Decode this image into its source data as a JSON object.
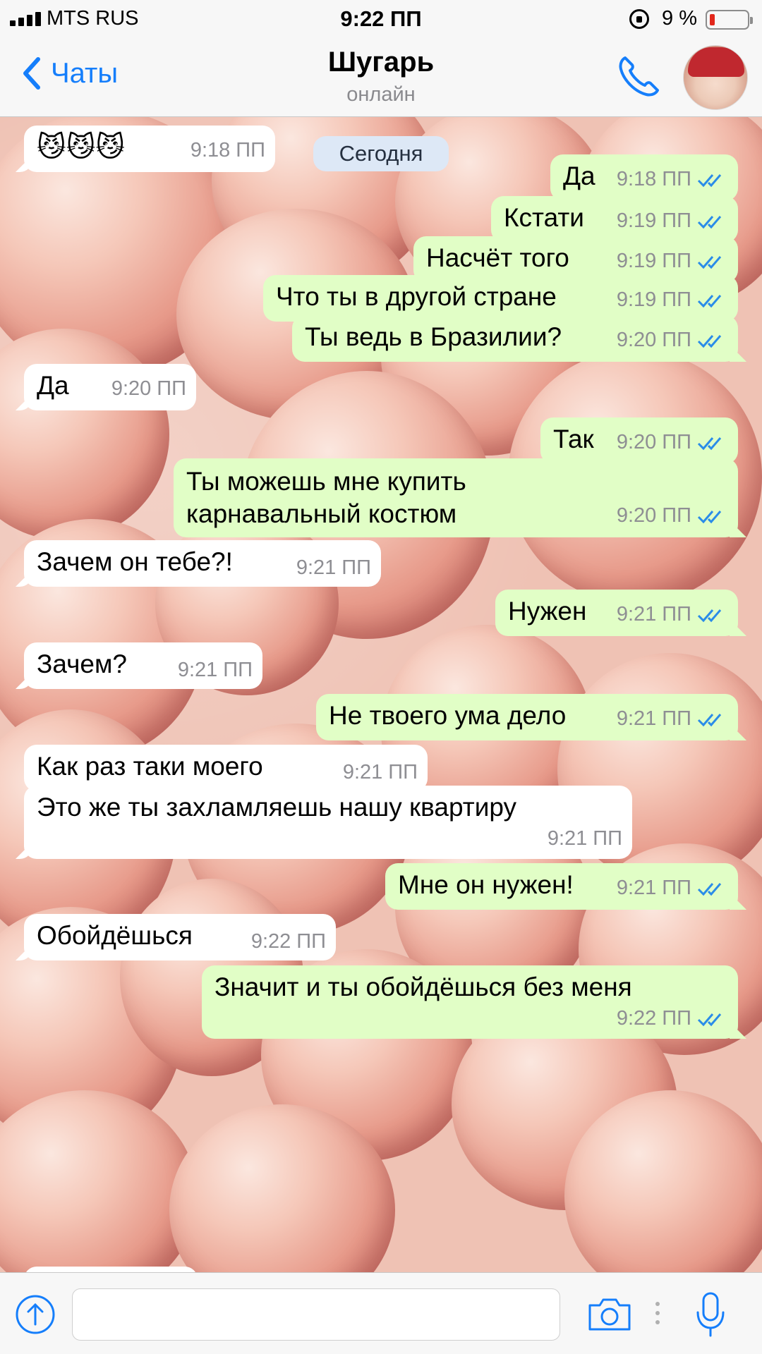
{
  "status_bar": {
    "carrier": "MTS RUS",
    "time": "9:22 ПП",
    "battery_percent": "9 %"
  },
  "header": {
    "back_label": "Чаты",
    "contact_name": "Шугарь",
    "contact_status": "онлайн"
  },
  "day_badge": "Сегодня",
  "messages": [
    {
      "dir": "in",
      "text": "😼😼😼",
      "time": "9:18 ПП"
    },
    {
      "dir": "out",
      "text": "Да",
      "time": "9:18 ПП"
    },
    {
      "dir": "out",
      "text": "Кстати",
      "time": "9:19 ПП"
    },
    {
      "dir": "out",
      "text": "Насчёт того",
      "time": "9:19 ПП"
    },
    {
      "dir": "out",
      "text": "Что ты в другой стране",
      "time": "9:19 ПП"
    },
    {
      "dir": "out",
      "text": "Ты ведь в Бразилии?",
      "time": "9:20 ПП"
    },
    {
      "dir": "in",
      "text": "Да",
      "time": "9:20 ПП"
    },
    {
      "dir": "out",
      "text": "Так",
      "time": "9:20 ПП"
    },
    {
      "dir": "out",
      "text": "Ты можешь мне купить карнавальный костюм",
      "time": "9:20 ПП"
    },
    {
      "dir": "in",
      "text": "Зачем он тебе?!",
      "time": "9:21 ПП"
    },
    {
      "dir": "out",
      "text": "Нужен",
      "time": "9:21 ПП"
    },
    {
      "dir": "in",
      "text": "Зачем?",
      "time": "9:21 ПП"
    },
    {
      "dir": "out",
      "text": "Не твоего ума дело",
      "time": "9:21 ПП"
    },
    {
      "dir": "in",
      "text": "Как раз таки моего",
      "time": "9:21 ПП"
    },
    {
      "dir": "in",
      "text": "Это же ты захламляешь нашу квартиру",
      "time": "9:21 ПП"
    },
    {
      "dir": "out",
      "text": "Мне он нужен!",
      "time": "9:21 ПП"
    },
    {
      "dir": "in",
      "text": "Обойдёшься",
      "time": "9:22 ПП"
    },
    {
      "dir": "out",
      "text": "Значит и ты обойдёшься без меня",
      "time": "9:22 ПП"
    }
  ],
  "colors": {
    "accent": "#157efb",
    "incoming_bubble": "#ffffff",
    "outgoing_bubble": "#e1fec6",
    "day_badge": "#dde8f6"
  },
  "icons": {
    "back": "chevron-left-icon",
    "call": "phone-icon",
    "attach": "arrow-up-circle-icon",
    "camera": "camera-icon",
    "mic": "microphone-icon"
  }
}
